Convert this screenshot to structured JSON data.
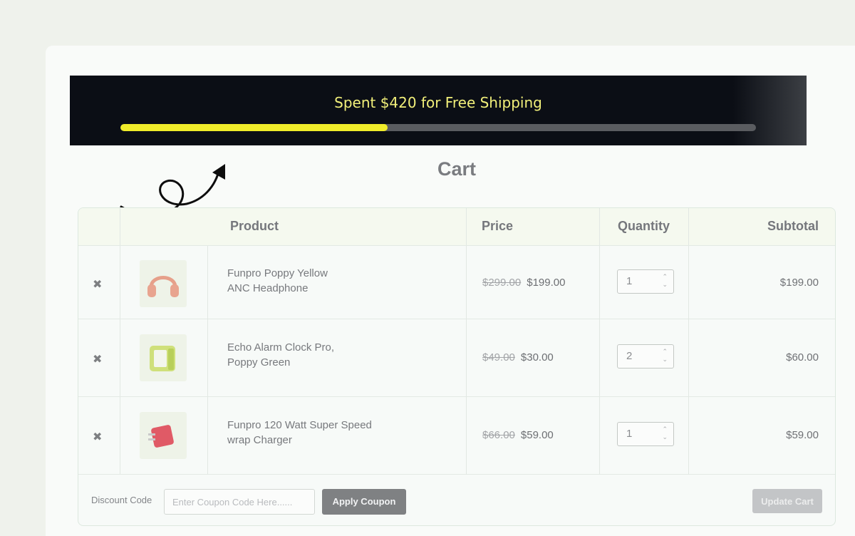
{
  "shipping_banner": {
    "message": "Spent $420 for Free Shipping",
    "progress": 0.42
  },
  "cart": {
    "title": "Cart",
    "columns": {
      "product": "Product",
      "price": "Price",
      "quantity": "Quantity",
      "subtotal": "Subtotal"
    },
    "items": [
      {
        "name_line1": "Funpro Poppy Yellow",
        "name_line2": "ANC Headphone",
        "old_price": "$299.00",
        "price": "$199.00",
        "quantity": "1",
        "subtotal": "$199.00",
        "thumb_icon": "headphone-icon"
      },
      {
        "name_line1": "Echo Alarm Clock Pro,",
        "name_line2": "Poppy Green",
        "old_price": "$49.00",
        "price": "$30.00",
        "quantity": "2",
        "subtotal": "$60.00",
        "thumb_icon": "alarm-clock-icon"
      },
      {
        "name_line1": "Funpro 120 Watt Super Speed",
        "name_line2": "wrap Charger",
        "old_price": "$66.00",
        "price": "$59.00",
        "quantity": "1",
        "subtotal": "$59.00",
        "thumb_icon": "charger-icon"
      }
    ],
    "remove_glyph": "✖",
    "discount_label": "Discount Code",
    "coupon_placeholder": "Enter Coupon Code Here......",
    "apply_label": "Apply Coupon",
    "update_label": "Update Cart"
  },
  "colors": {
    "banner_bg": "#0b0e15",
    "banner_text": "#f2f07a",
    "progress_fill": "#f0ec2a",
    "progress_track": "#5a5c60"
  }
}
